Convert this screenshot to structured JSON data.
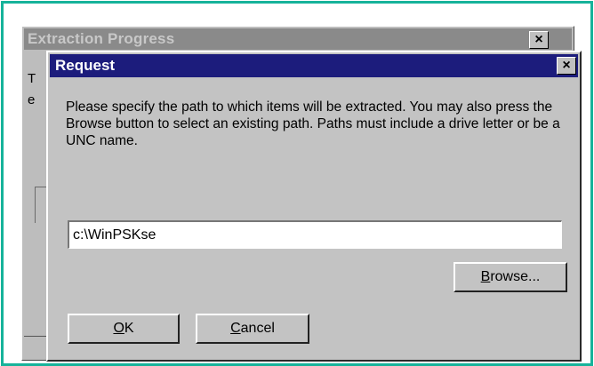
{
  "background_window": {
    "title": "Extraction Progress",
    "close_glyph": "×",
    "partial_lines": [
      "T",
      "e"
    ]
  },
  "dialog": {
    "title": "Request",
    "close_glyph": "×",
    "message": "Please specify the path to which items will be extracted.  You may also press the Browse button to select an existing path.  Paths must include a drive letter or be a UNC name.",
    "path_value": "c:\\WinPSKse",
    "browse": {
      "mnemonic": "B",
      "rest": "rowse..."
    },
    "ok": {
      "mnemonic": "O",
      "rest": "K"
    },
    "cancel": {
      "mnemonic": "C",
      "rest": "ancel"
    }
  },
  "colors": {
    "frame": "#16b39a",
    "active_titlebar": "#1c1c7c",
    "inactive_titlebar": "#8a8a8a",
    "face": "#c3c3c3"
  }
}
